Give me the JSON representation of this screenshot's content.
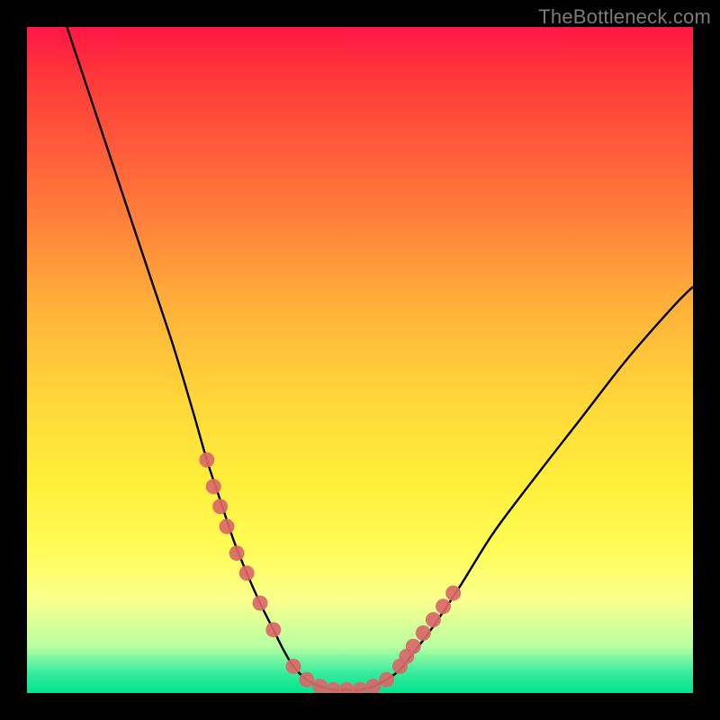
{
  "watermark": {
    "text": "TheBottleneck.com"
  },
  "colors": {
    "frame": "#000000",
    "curve": "#000000",
    "marker": "#d96868",
    "gradient_stops": [
      "#ff1744",
      "#ff3a3a",
      "#ff5b3a",
      "#ff843a",
      "#ffb13a",
      "#ffd43a",
      "#ffee3a",
      "#fffc55",
      "#fbff8c",
      "#b8ffa2",
      "#37ec9d",
      "#00e58f"
    ]
  },
  "chart_data": {
    "type": "line",
    "title": "",
    "xlabel": "",
    "ylabel": "",
    "xlim": [
      0,
      100
    ],
    "ylim": [
      0,
      100
    ],
    "annotations": [
      "TheBottleneck.com"
    ],
    "legend": false,
    "grid": false,
    "series": [
      {
        "name": "curve",
        "x": [
          6,
          10,
          14,
          18,
          22,
          25,
          27,
          29,
          31,
          33,
          35,
          37,
          38.5,
          40,
          42,
          44,
          46,
          48,
          50,
          52,
          54,
          56,
          58,
          61,
          65,
          70,
          76,
          83,
          90,
          97,
          100
        ],
        "y": [
          100,
          88,
          76,
          64,
          52,
          42,
          35,
          29,
          23,
          18,
          13.5,
          9.5,
          6.5,
          4,
          2,
          1,
          0.5,
          0.5,
          0.5,
          1,
          2,
          3.5,
          6,
          10,
          16,
          24,
          32,
          41,
          50,
          58,
          61
        ]
      },
      {
        "name": "markers",
        "type": "scatter",
        "x": [
          27,
          28,
          29,
          30,
          31.5,
          33,
          35,
          37,
          40,
          42,
          44,
          46,
          48,
          50,
          52,
          54,
          56,
          57,
          58,
          59.5,
          61,
          62.5,
          64
        ],
        "y": [
          35,
          31,
          28,
          25,
          21,
          18,
          13.5,
          9.5,
          4,
          2,
          1,
          0.5,
          0.5,
          0.5,
          1,
          2,
          4,
          5.5,
          7,
          9,
          11,
          13,
          15
        ]
      }
    ]
  }
}
